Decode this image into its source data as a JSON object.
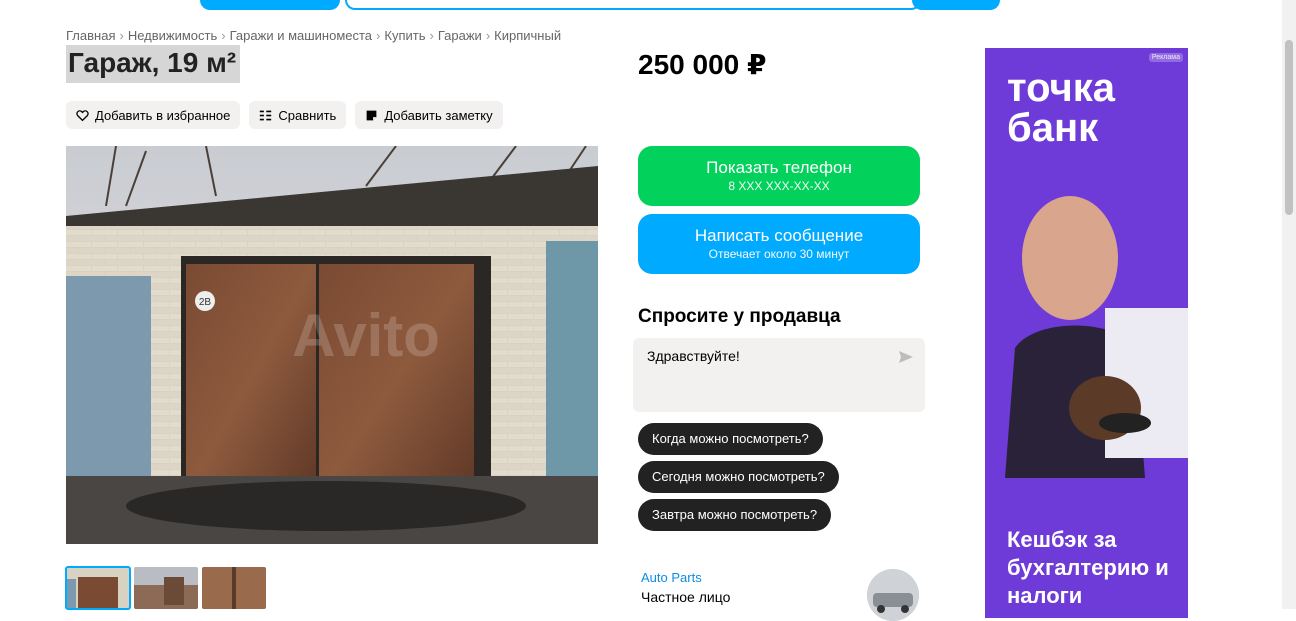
{
  "breadcrumb": {
    "items": [
      "Главная",
      "Недвижимость",
      "Гаражи и машиноместа",
      "Купить",
      "Гаражи",
      "Кирпичный"
    ],
    "separator": "›"
  },
  "listing": {
    "title": "Гараж, 19 м²",
    "price": "250 000 ₽"
  },
  "actions": {
    "favorite": "Добавить в избранное",
    "compare": "Сравнить",
    "note": "Добавить заметку"
  },
  "photo": {
    "watermark": "Avito",
    "door_number": "2B",
    "thumbnail_count": 3
  },
  "contact": {
    "phone_label": "Показать телефон",
    "phone_mask": "8 XXX XXX-XX-XX",
    "message_label": "Написать сообщение",
    "message_sub": "Отвечает около 30 минут"
  },
  "ask": {
    "title": "Спросите у продавца",
    "message": "Здравствуйте!",
    "quick_replies": [
      "Когда можно посмотреть?",
      "Сегодня можно посмотреть?",
      "Завтра можно посмотреть?"
    ]
  },
  "seller": {
    "name": "Auto Parts",
    "type": "Частное лицо"
  },
  "ad": {
    "badge": "Реклама",
    "brand": "точка банк",
    "text": "Кешбэк за бухгалтерию и налоги"
  },
  "colors": {
    "green": "#02d15c",
    "blue": "#00aaff",
    "dark": "#222222",
    "light_bg": "#f2f1f0",
    "ad_purple": "#6e3ad8"
  }
}
